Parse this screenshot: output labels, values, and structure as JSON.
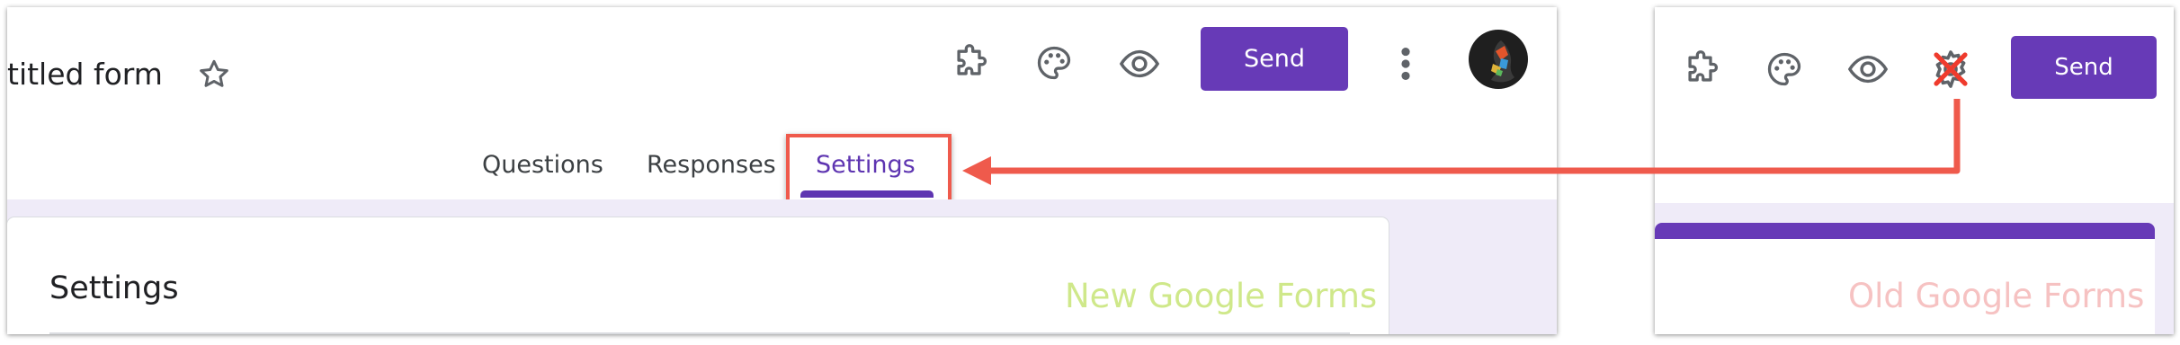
{
  "new_ui": {
    "form_title": "titled form",
    "send_label": "Send",
    "tabs": [
      {
        "label": "Questions"
      },
      {
        "label": "Responses"
      },
      {
        "label": "Settings",
        "active": true
      }
    ],
    "card_title": "Settings",
    "watermark": "New Google Forms",
    "icons": [
      "star-icon",
      "puzzle-icon",
      "palette-icon",
      "eye-icon",
      "more-vert-icon",
      "avatar"
    ]
  },
  "old_ui": {
    "send_label": "Send",
    "watermark": "Old Google Forms",
    "icons": [
      "puzzle-icon",
      "palette-icon",
      "eye-icon",
      "gear-icon-crossed-out"
    ]
  },
  "colors": {
    "brand_purple": "#673ab7",
    "tab_active": "#5e35b1",
    "content_bg": "#efebf8",
    "annotation_red": "#ef5a4c",
    "watermark_new": "#cfe88a",
    "watermark_old": "#f6c2c2"
  }
}
